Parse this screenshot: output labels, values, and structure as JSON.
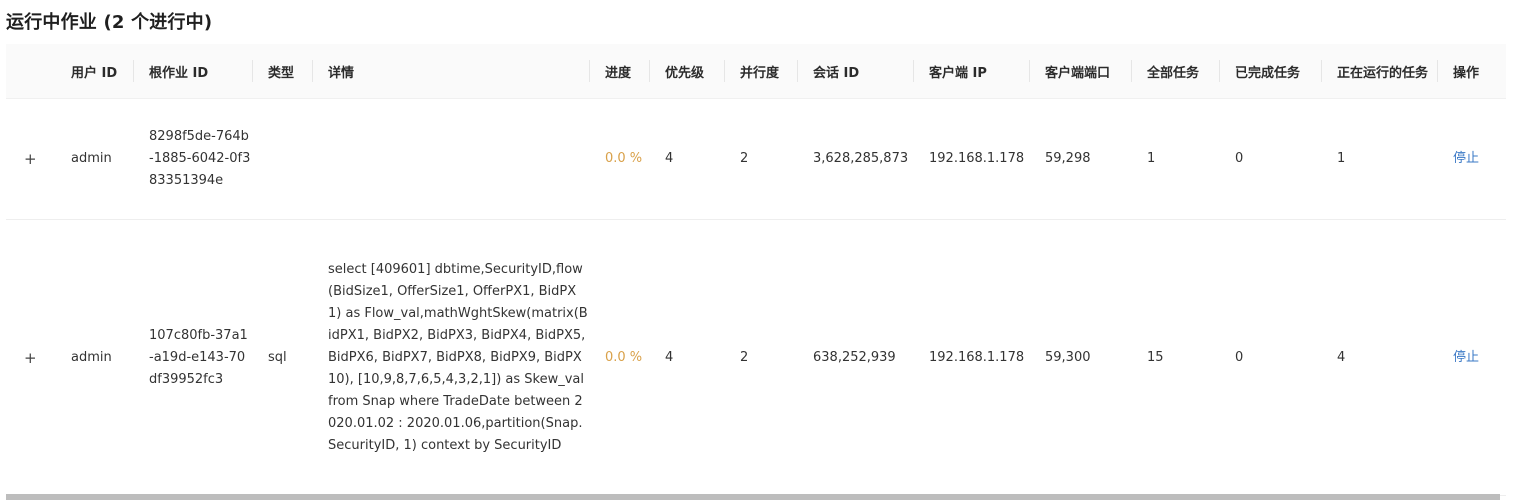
{
  "header": {
    "title": "运行中作业",
    "count_text": "(2 个进行中)"
  },
  "table": {
    "columns": [
      "用户 ID",
      "根作业 ID",
      "类型",
      "详情",
      "进度",
      "优先级",
      "并行度",
      "会话 ID",
      "客户端 IP",
      "客户端端口",
      "全部任务",
      "已完成任务",
      "正在运行的任务",
      "操作"
    ],
    "rows": [
      {
        "expand": "+",
        "user_id": "admin",
        "root_job_id": "8298f5de-764b-1885-6042-0f383351394e",
        "type": "",
        "detail": "",
        "progress": "0.0 %",
        "priority": "4",
        "parallelism": "2",
        "session_id": "3,628,285,873",
        "client_ip": "192.168.1.178",
        "client_port": "59,298",
        "total_tasks": "1",
        "finished_tasks": "0",
        "running_tasks": "1",
        "action": "停止"
      },
      {
        "expand": "+",
        "user_id": "admin",
        "root_job_id": "107c80fb-37a1-a19d-e143-70df39952fc3",
        "type": "sql",
        "detail": "select [409601] dbtime,SecurityID,flow(BidSize1, OfferSize1, OfferPX1, BidPX1) as Flow_val,mathWghtSkew(matrix(BidPX1, BidPX2, BidPX3, BidPX4, BidPX5, BidPX6, BidPX7, BidPX8, BidPX9, BidPX10), [10,9,8,7,6,5,4,3,2,1]) as Skew_val from Snap where TradeDate between 2020.01.02 : 2020.01.06,partition(Snap.SecurityID, 1) context by SecurityID",
        "progress": "0.0 %",
        "priority": "4",
        "parallelism": "2",
        "session_id": "638,252,939",
        "client_ip": "192.168.1.178",
        "client_port": "59,300",
        "total_tasks": "15",
        "finished_tasks": "0",
        "running_tasks": "4",
        "action": "停止"
      }
    ]
  },
  "colors": {
    "progress": "#d9a14a",
    "link": "#3a78c6",
    "header_bg": "#fafafa"
  }
}
